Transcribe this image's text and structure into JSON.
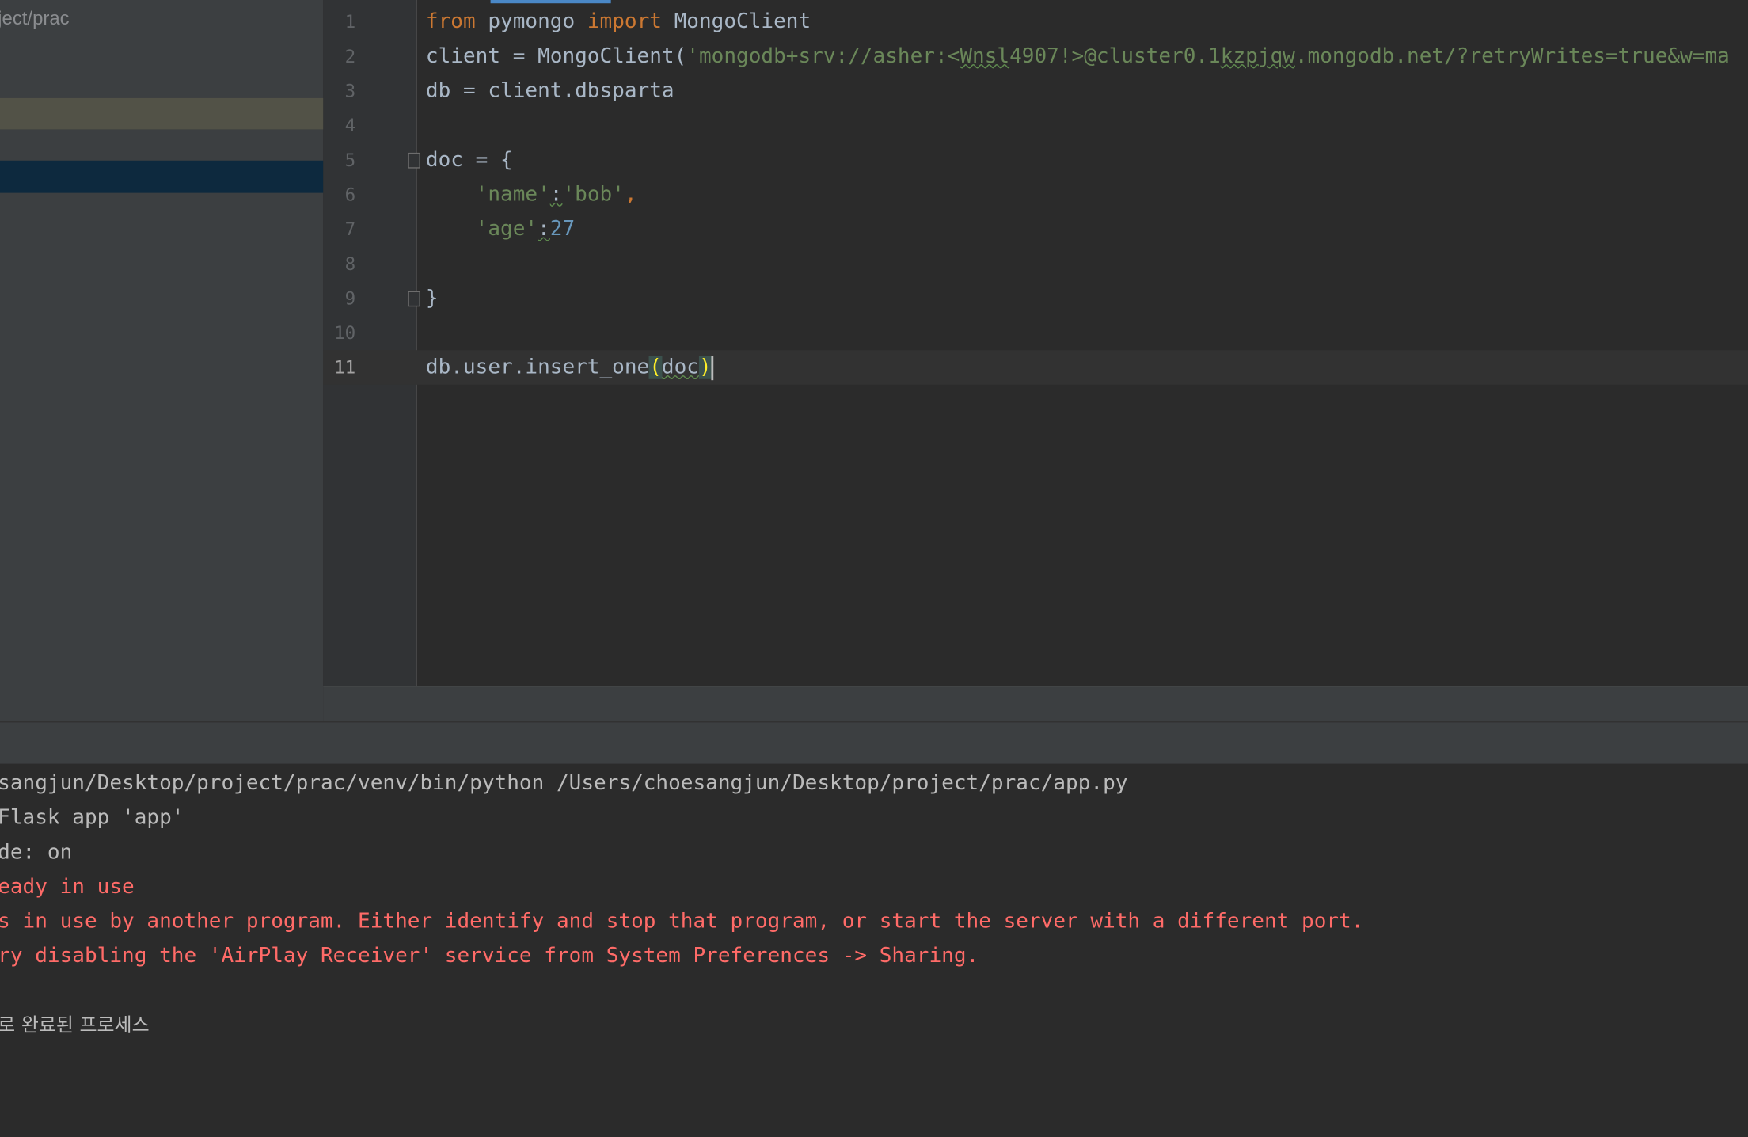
{
  "sidebar": {
    "project_path": "ject/prac"
  },
  "editor": {
    "lines": [
      {
        "num": "1"
      },
      {
        "num": "2"
      },
      {
        "num": "3"
      },
      {
        "num": "4"
      },
      {
        "num": "5"
      },
      {
        "num": "6"
      },
      {
        "num": "7"
      },
      {
        "num": "8"
      },
      {
        "num": "9"
      },
      {
        "num": "10"
      },
      {
        "num": "11"
      }
    ],
    "code": {
      "l1": {
        "kw_from": "from",
        "module": " pymongo ",
        "kw_import": "import",
        "name": " MongoClient"
      },
      "l2": {
        "prefix": "client = MongoClient(",
        "str_a": "'mongodb+srv://asher:<",
        "str_sq1": "Wnsl",
        "str_b": "4907!>@cluster0.1",
        "str_sq2": "kzpjqw",
        "str_c": ".mongodb.net/?retryWrites=true&w=ma"
      },
      "l3": {
        "text": "db = client.dbsparta"
      },
      "l5": {
        "text": "doc = {"
      },
      "l6": {
        "indent": "    ",
        "key": "'name'",
        "colon": ":",
        "value": "'bob'",
        "comma": ","
      },
      "l7": {
        "indent": "    ",
        "key": "'age'",
        "colon": ":",
        "value": "27"
      },
      "l9": {
        "text": "}"
      },
      "l11": {
        "prefix": "db.user.insert_one",
        "open_paren": "(",
        "arg": "doc",
        "close_paren": ")"
      }
    }
  },
  "console": {
    "lines": [
      {
        "text": "sangjun/Desktop/project/prac/venv/bin/python /Users/choesangjun/Desktop/project/prac/app.py",
        "error": false
      },
      {
        "text": "Flask app 'app'",
        "error": false
      },
      {
        "text": "de: on",
        "error": false
      },
      {
        "text": "eady in use",
        "error": true
      },
      {
        "text": "s in use by another program. Either identify and stop that program, or start the server with a different port.",
        "error": true
      },
      {
        "text": "ry disabling the 'AirPlay Receiver' service from System Preferences -> Sharing.",
        "error": true
      },
      {
        "text": "로 완료된 프로세스",
        "error": false
      }
    ]
  },
  "colors": {
    "keyword": "#cc7832",
    "string": "#6a8759",
    "number": "#6897bb",
    "default_text": "#a9b7c6",
    "error_text": "#ff6b68",
    "editor_bg": "#2b2b2b",
    "sidebar_bg": "#3c3f41"
  }
}
